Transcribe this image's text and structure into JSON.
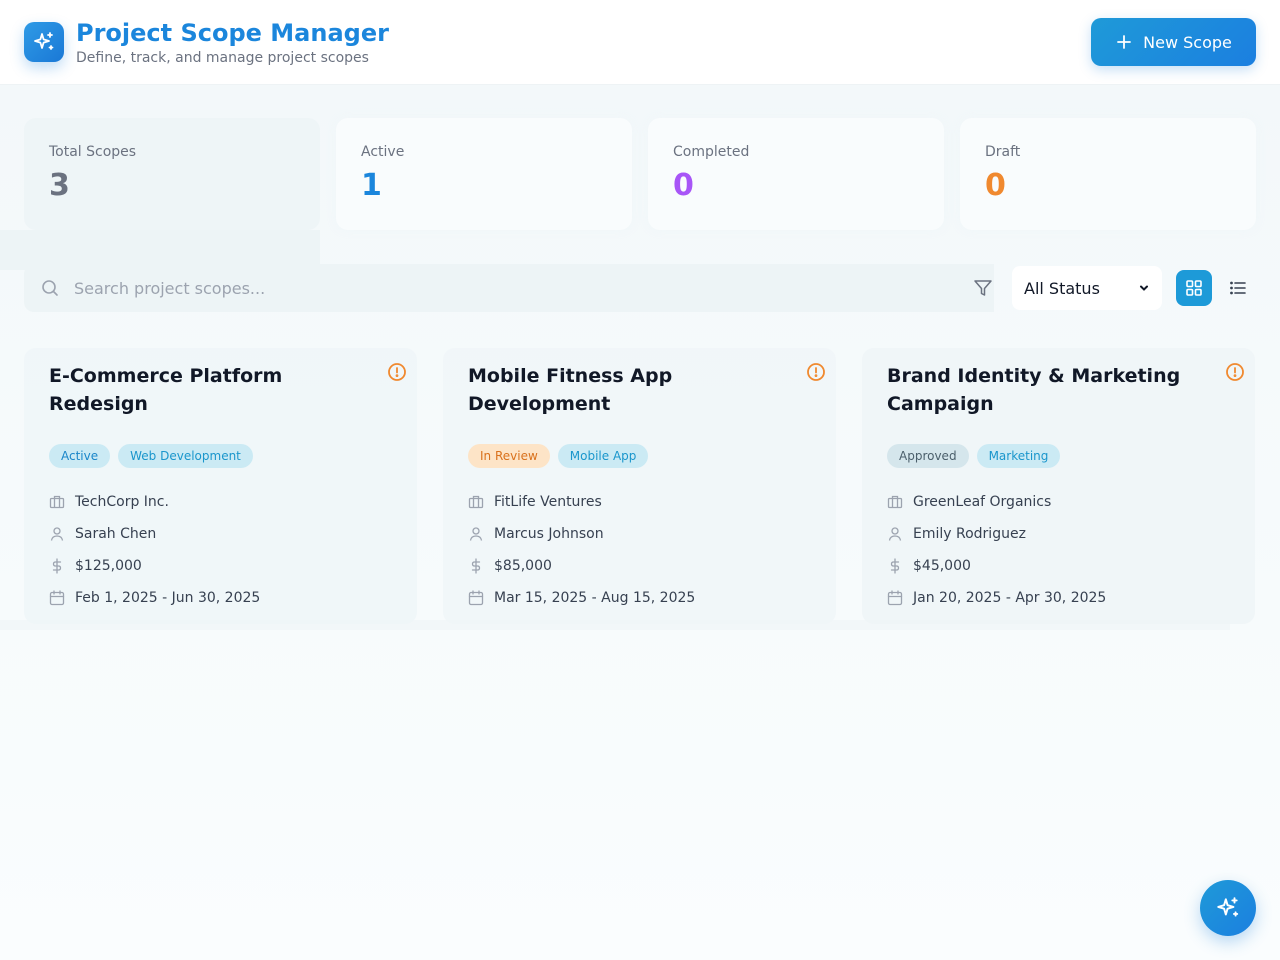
{
  "header": {
    "title": "Project Scope Manager",
    "subtitle": "Define, track, and manage project scopes",
    "new_button_label": "New Scope",
    "logo_icon": "sparkles-icon"
  },
  "stats": [
    {
      "label": "Total Scopes",
      "value": "3",
      "color": "#6b7280"
    },
    {
      "label": "Active",
      "value": "1",
      "color": "#1b86dc"
    },
    {
      "label": "Completed",
      "value": "0",
      "color": "#a855f7"
    },
    {
      "label": "Draft",
      "value": "0",
      "color": "#f0892f"
    }
  ],
  "toolbar": {
    "search_placeholder": "Search project scopes...",
    "status_filter_selected": "All Status",
    "view_modes": [
      "grid",
      "list"
    ],
    "active_view": "grid"
  },
  "projects": [
    {
      "title": "E-Commerce Platform Redesign",
      "status": "Active",
      "category": "Web Development",
      "client": "TechCorp Inc.",
      "manager": "Sarah Chen",
      "budget": "$125,000",
      "dates": "Feb 1, 2025 - Jun 30, 2025"
    },
    {
      "title": "Mobile Fitness App Development",
      "status": "In Review",
      "category": "Mobile App",
      "client": "FitLife Ventures",
      "manager": "Marcus Johnson",
      "budget": "$85,000",
      "dates": "Mar 15, 2025 - Aug 15, 2025"
    },
    {
      "title": "Brand Identity & Marketing Campaign",
      "status": "Approved",
      "category": "Marketing",
      "client": "GreenLeaf Organics",
      "manager": "Emily Rodriguez",
      "budget": "$45,000",
      "dates": "Jan 20, 2025 - Apr 30, 2025"
    }
  ],
  "colors": {
    "brand": "#1b86dc",
    "alert": "#f0892f"
  }
}
